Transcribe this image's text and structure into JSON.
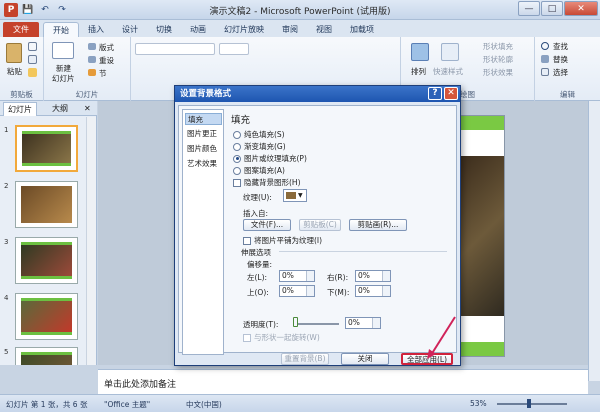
{
  "window": {
    "title": "演示文稿2 - Microsoft PowerPoint (试用版)",
    "minimize": "—",
    "maximize": "□",
    "close": "✕"
  },
  "qat": {
    "save": "💾",
    "undo": "↶",
    "redo": "↷"
  },
  "tabs": {
    "file": "文件",
    "home": "开始",
    "insert": "插入",
    "design": "设计",
    "transitions": "切换",
    "animations": "动画",
    "slideshow": "幻灯片放映",
    "review": "审阅",
    "view": "视图",
    "addins": "加载项"
  },
  "ribbon": {
    "clipboard": {
      "label": "剪贴板",
      "paste": "粘贴"
    },
    "slides": {
      "label": "幻灯片",
      "new_slide": "新建",
      "new_slide2": "幻灯片",
      "layout": "版式",
      "reset": "重设",
      "section": "节"
    },
    "shapes": {
      "arrange": "排列",
      "quick_styles": "快速样式",
      "fill": "形状填充",
      "outline": "形状轮廓",
      "effects": "形状效果",
      "drawing": "绘图"
    },
    "editing": {
      "label": "编辑",
      "find": "查找",
      "replace": "替换",
      "select": "选择"
    }
  },
  "pane": {
    "tab_slides": "幻灯片",
    "tab_outline": "大纲",
    "close": "✕",
    "slide_numbers": [
      "1",
      "2",
      "3",
      "4",
      "5"
    ]
  },
  "notes": {
    "placeholder": "单击此处添加备注"
  },
  "status": {
    "slide": "幻灯片 第 1 张，共 6 张",
    "theme": "\"Office 主题\"",
    "lang": "中文(中国)",
    "zoom": "53%"
  },
  "dialog": {
    "title": "设置背景格式",
    "help": "?",
    "close": "✕",
    "categories": [
      "填充",
      "图片更正",
      "图片颜色",
      "艺术效果"
    ],
    "fill_title": "填充",
    "options": [
      "纯色填充(S)",
      "渐变填充(G)",
      "图片或纹理填充(P)",
      "图案填充(A)"
    ],
    "hide_bg": "隐藏背景图形(H)",
    "texture_label": "纹理(U):",
    "insert_from": "插入自:",
    "btn_file": "文件(F)...",
    "btn_clipboard": "剪贴板(C)",
    "btn_clipart": "剪贴画(R)...",
    "tile": "将图片平铺为纹理(I)",
    "stretch": "伸展选项",
    "offset": "偏移量:",
    "left": "左(L):",
    "right": "右(R):",
    "top": "上(O):",
    "bottom": "下(M):",
    "left_val": "0%",
    "right_val": "0%",
    "top_val": "0%",
    "bottom_val": "0%",
    "transparency": "透明度(T):",
    "transparency_val": "0%",
    "rotate": "与形状一起旋转(W)",
    "btn_reset": "重置背景(B)",
    "btn_close": "关闭",
    "btn_apply_all": "全部应用(L)"
  }
}
